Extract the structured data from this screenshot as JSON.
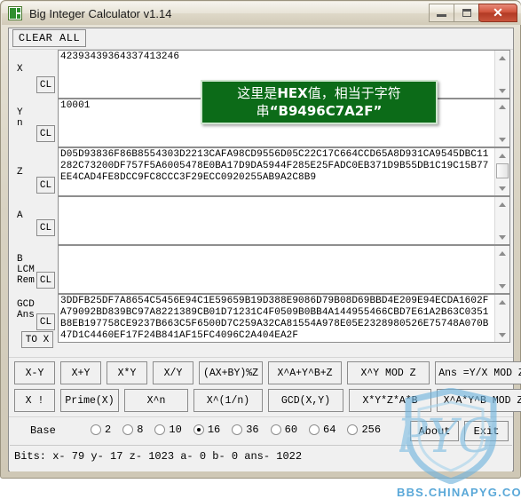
{
  "window": {
    "title": "Big Integer Calculator v1.14",
    "icon": "app-icon",
    "minimize_label": "",
    "maximize_label": "",
    "close_label": "✕"
  },
  "toolbar": {
    "clear_all_label": "CLEAR ALL"
  },
  "fields": [
    {
      "label": "X",
      "clear_label": "CL",
      "value": "42393439364337413246",
      "scroll_thumb": false
    },
    {
      "label": "Y\nn",
      "clear_label": "CL",
      "value": "10001",
      "scroll_thumb": false
    },
    {
      "label": "Z",
      "clear_label": "CL",
      "value": "D05D93836F86B8554303D2213CAFA98CD9556D05C22C17C664CCD65A8D931CA9545DBC11282C73200DF757F5A6005478E0BA17D9DA5944F285E25FADC0EB371D9B55DB1C19C15B77EE4CAD4FE8DCC9FC8CCC3F29ECC0920255AB9A2C8B9",
      "scroll_thumb": true
    },
    {
      "label": "A",
      "clear_label": "CL",
      "value": "",
      "scroll_thumb": false
    },
    {
      "label": "B\nLCM\nRem.",
      "clear_label": "CL",
      "value": "",
      "scroll_thumb": false
    },
    {
      "label": "GCD\nAns",
      "clear_label": "CL",
      "to_x_label": "TO X",
      "value": "3DDFB25DF7A8654C5456E94C1E59659B19D388E9086D79B08D69BBD4E209E94ECDA1602FA79092BD839BC97A8221389CB01D71231C4F0509B0BB4A144955466CBD7E61A2B63C0351B8EB197758CE9237B663C5F6500D7C259A32CA81554A978E05E2328980526E75748A070B47D1C4460EF17F24B841AF15FC4096C2A404EA2F",
      "scroll_thumb": false
    }
  ],
  "annotation": {
    "line1_a": "这里是",
    "line1_b": "HEX",
    "line1_c": "值，相当于字符",
    "line2_a": "串",
    "line2_b": "“B9496C7A2F”",
    "color": "#0c6b18"
  },
  "operations": {
    "row1": [
      "X-Y",
      "X+Y",
      "X*Y",
      "X/Y",
      "(AX+BY)%Z",
      "X^A+Y^B+Z",
      "X^Y MOD Z",
      "Ans =Y/X MOD Z"
    ],
    "row2": [
      "X !",
      "Prime(X)",
      "X^n",
      "X^(1/n)",
      "GCD(X,Y)",
      "X*Y*Z*A*B",
      "X^A*Y^B MOD Z"
    ]
  },
  "base": {
    "label": "Base",
    "options": [
      "2",
      "8",
      "10",
      "16",
      "36",
      "60",
      "64",
      "256"
    ],
    "selected": "16",
    "about_label": "About",
    "exit_label": "Exit"
  },
  "status": {
    "text": "Bits: x- 79 y- 17 z- 1023 a- 0 b- 0 ans- 1022"
  },
  "watermark": {
    "text": "BBS.CHINAPYG.COM",
    "color": "#5aa8d8"
  }
}
